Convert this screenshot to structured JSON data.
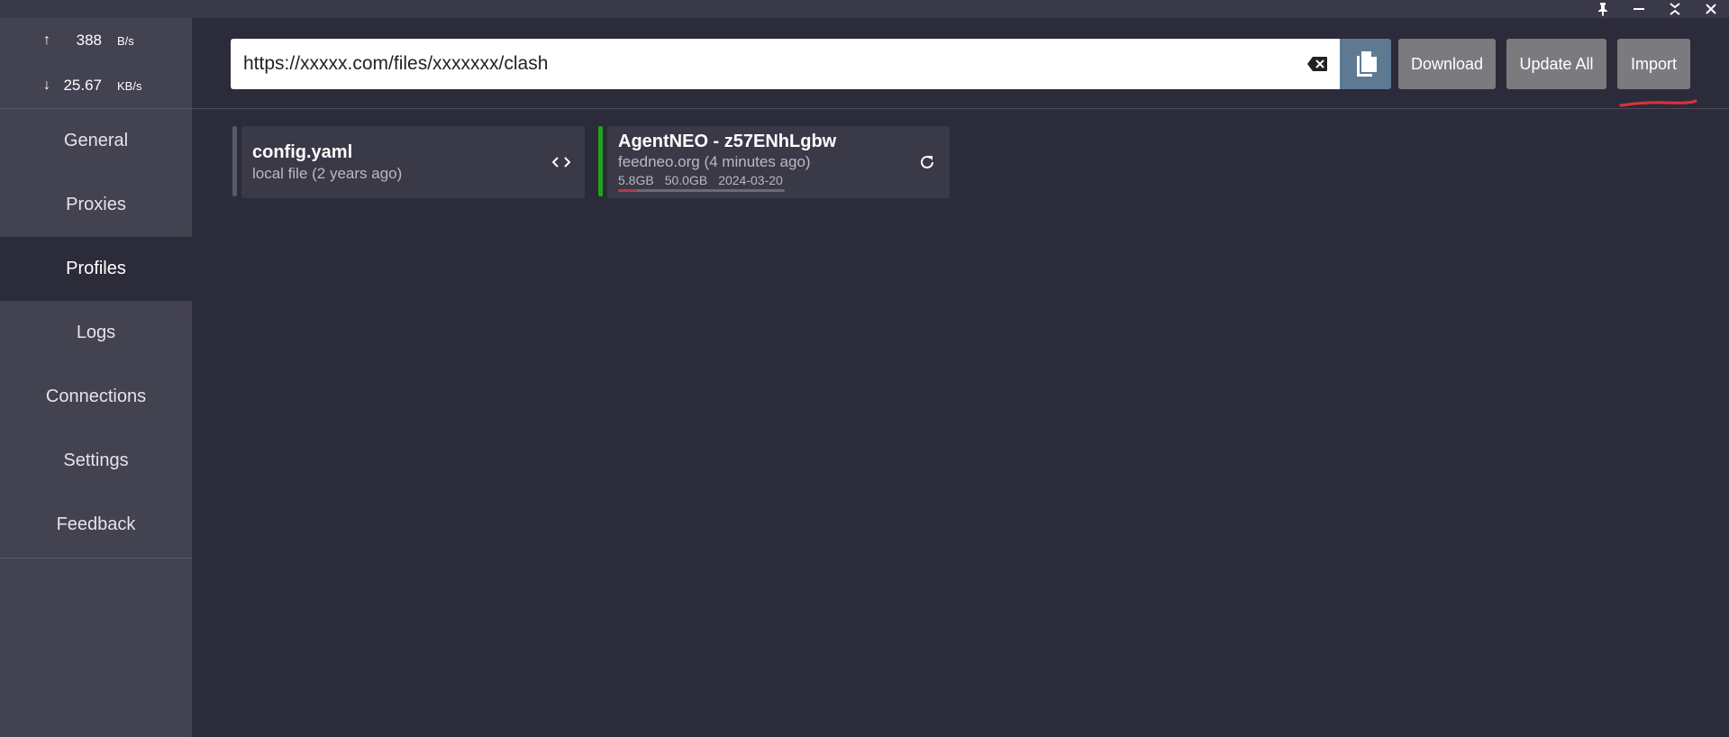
{
  "traffic": {
    "up_arrow": "↑",
    "up_value": "388",
    "up_unit": "B/s",
    "down_arrow": "↓",
    "down_value": "25.67",
    "down_unit": "KB/s"
  },
  "nav": {
    "items": [
      {
        "label": "General"
      },
      {
        "label": "Proxies"
      },
      {
        "label": "Profiles"
      },
      {
        "label": "Logs"
      },
      {
        "label": "Connections"
      },
      {
        "label": "Settings"
      },
      {
        "label": "Feedback"
      }
    ],
    "active": "Profiles"
  },
  "toolbar": {
    "url_value": "https://xxxxx.com/files/xxxxxxx/clash",
    "download_label": "Download",
    "update_all_label": "Update All",
    "import_label": "Import"
  },
  "profiles": [
    {
      "title": "config.yaml",
      "subtitle": "local file (2 years ago)",
      "action_icon": "code-icon",
      "bar_color": "#5a5968"
    },
    {
      "title": "AgentNEO - z57ENhLgbw",
      "subtitle": "feedneo.org (4 minutes ago)",
      "used": "5.8GB",
      "total": "50.0GB",
      "expire": "2024-03-20",
      "usage_fraction": 0.116,
      "action_icon": "refresh-icon",
      "bar_color": "#1fa31f"
    }
  ],
  "colors": {
    "accent_annotation": "#e0313b",
    "paste_button": "#5d7a92",
    "active_profile": "#1fa31f"
  }
}
